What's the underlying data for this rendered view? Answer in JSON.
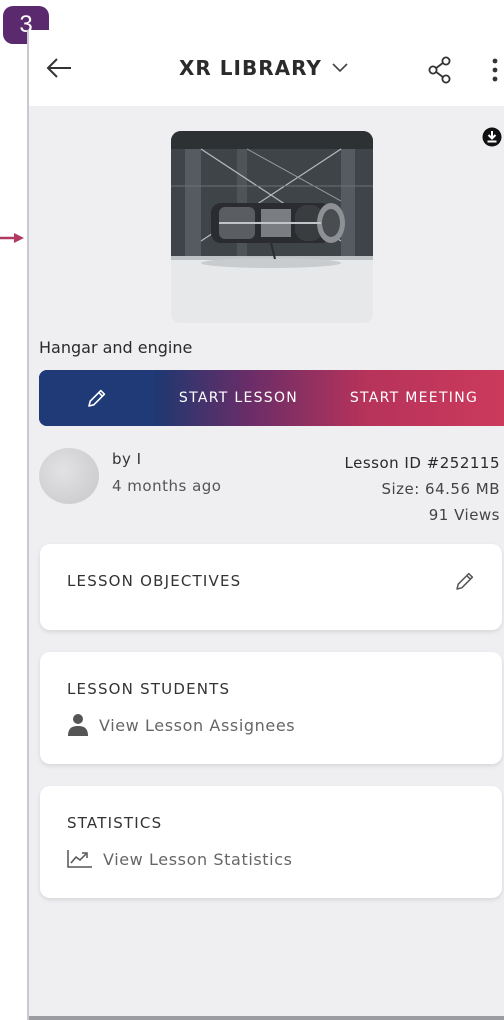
{
  "step_badge": "3",
  "colors": {
    "accent_navy": "#203a78",
    "accent_pink": "#cc3a5c",
    "badge": "#5b2a6e"
  },
  "appbar": {
    "title": "XR LIBRARY",
    "icons": [
      "back-arrow-icon",
      "chevron-down-icon",
      "share-icon",
      "more-vertical-icon"
    ]
  },
  "lesson": {
    "title": "Hangar and engine",
    "by": "by I",
    "age": "4 months ago",
    "id": "Lesson ID #252115",
    "size": "Size: 64.56 MB",
    "views": "91 Views"
  },
  "actions": {
    "start_lesson": "START LESSON",
    "start_meeting": "START MEETING"
  },
  "cards": {
    "objectives": {
      "title": "LESSON OBJECTIVES"
    },
    "students": {
      "title": "LESSON STUDENTS",
      "link": "View Lesson Assignees"
    },
    "statistics": {
      "title": "STATISTICS",
      "link": "View Lesson Statistics"
    }
  }
}
